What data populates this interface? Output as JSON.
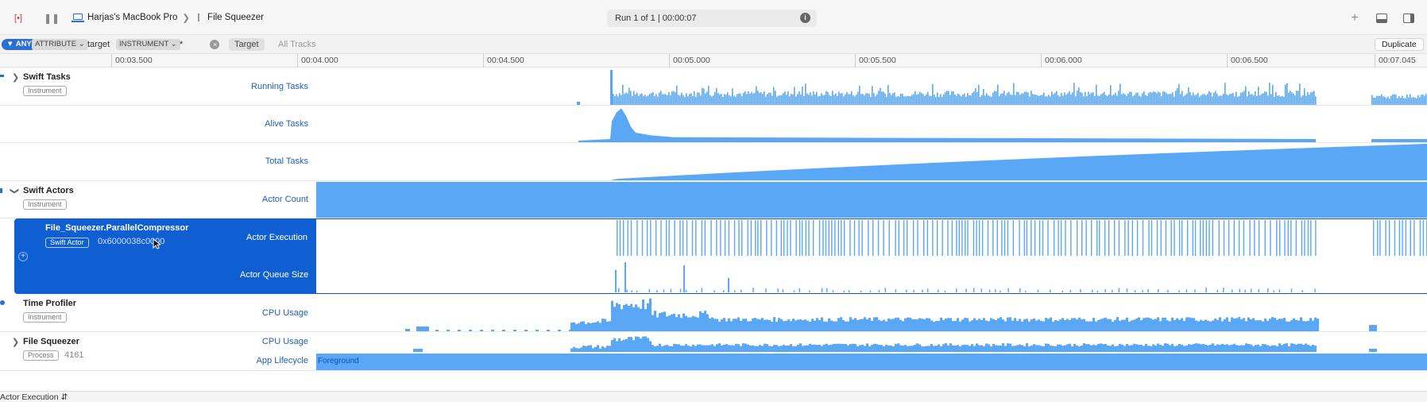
{
  "toolbar": {
    "device": "Harjas's MacBook Pro",
    "target": "File Squeezer",
    "run": "Run 1 of 1  |  00:00:07",
    "info_icon": "info-icon"
  },
  "filter": {
    "any": "ANY",
    "attribute": "ATTRIBUTE",
    "attribute_value": "target",
    "instrument": "INSTRUMENT",
    "instrument_value": "*",
    "tab_target": "Target",
    "tab_all_tracks": "All Tracks",
    "duplicate": "Duplicate"
  },
  "ruler": {
    "ticks": [
      "00:03.500",
      "00:04.000",
      "00:04.500",
      "00:05.000",
      "00:05.500",
      "00:06.000",
      "00:06.500",
      "00:07.045"
    ]
  },
  "groups": {
    "swift_tasks": {
      "name": "Swift Tasks",
      "badge": "Instrument",
      "tracks": [
        "Running Tasks",
        "Alive Tasks",
        "Total Tasks"
      ]
    },
    "swift_actors": {
      "name": "Swift Actors",
      "badge": "Instrument",
      "tracks": [
        "Actor Count"
      ]
    },
    "actor": {
      "name": "File_Squeezer.ParallelCompressor",
      "badge": "Swift Actor",
      "address": "0x6000038c0000",
      "tracks": [
        "Actor Execution",
        "Actor Queue Size"
      ]
    },
    "time_profiler": {
      "name": "Time Profiler",
      "badge": "Instrument",
      "tracks": [
        "CPU Usage"
      ]
    },
    "file_squeezer": {
      "name": "File Squeezer",
      "badge": "Process",
      "pid": "4161",
      "tracks": [
        "CPU Usage",
        "App Lifecycle"
      ],
      "lifecycle_state": "Foreground"
    }
  },
  "status": {
    "selector": "Actor Execution"
  },
  "colors": {
    "accent": "#2a6fd6",
    "graph": "#5aa7f5",
    "selection": "#0f5fd3",
    "label": "#1f5fb8"
  }
}
